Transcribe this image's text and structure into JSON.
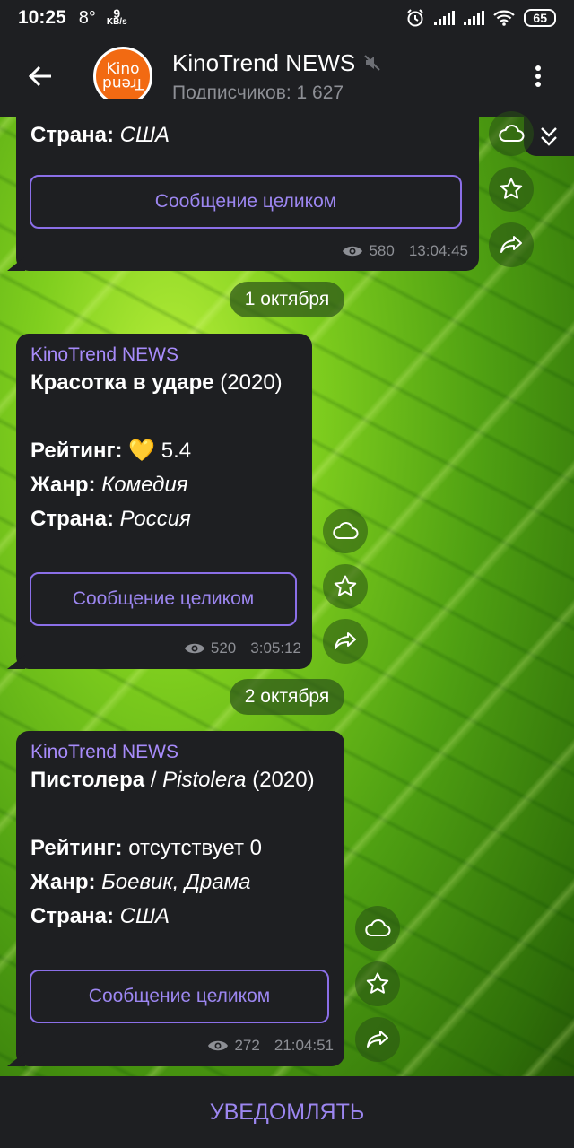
{
  "status_bar": {
    "time": "10:25",
    "temperature": "8°",
    "speed_value": "9",
    "speed_unit": "KB/s",
    "battery": "65",
    "icons": [
      "alarm-icon",
      "signal-icon",
      "signal-icon",
      "wifi-icon",
      "battery-icon"
    ]
  },
  "header": {
    "title": "KinoTrend NEWS",
    "subscribers": "Подписчиков: 1 627",
    "avatar_text_top": "Kino",
    "avatar_text_bottom": "Trend",
    "icons": [
      "back-arrow-icon",
      "muted-speaker-icon",
      "more-vert-icon"
    ]
  },
  "messages": [
    {
      "partial_line_label": "Страна:",
      "partial_line_value": "США",
      "button": "Сообщение целиком",
      "views": "580",
      "time": "13:04:45"
    },
    {
      "date_chip": "1 октября",
      "sender": "KinoTrend NEWS",
      "title_bold": "Красотка в ударе",
      "title_year": "(2020)",
      "rating_label": "Рейтинг:",
      "rating_emoji": "💛",
      "rating_value": "5.4",
      "genre_label": "Жанр:",
      "genre_value": "Комедия",
      "country_label": "Страна:",
      "country_value": "Россия",
      "button": "Сообщение целиком",
      "views": "520",
      "time": "3:05:12"
    },
    {
      "date_chip": "2 октября",
      "sender": "KinoTrend NEWS",
      "title_bold": "Пистолера",
      "title_sep": "/",
      "title_italic": "Pistolera",
      "title_year": "(2020)",
      "rating_label": "Рейтинг:",
      "rating_value": "отсутствует 0",
      "genre_label": "Жанр:",
      "genre_value": "Боевик, Драма",
      "country_label": "Страна:",
      "country_value": "США",
      "button": "Сообщение целиком",
      "views": "272",
      "time": "21:04:51"
    }
  ],
  "bottom_bar": {
    "label": "УВЕДОМЛЯТЬ"
  },
  "colors": {
    "bar_bg": "#1e1f22",
    "accent": "#9c86f0",
    "avatar": "#f26a12"
  }
}
